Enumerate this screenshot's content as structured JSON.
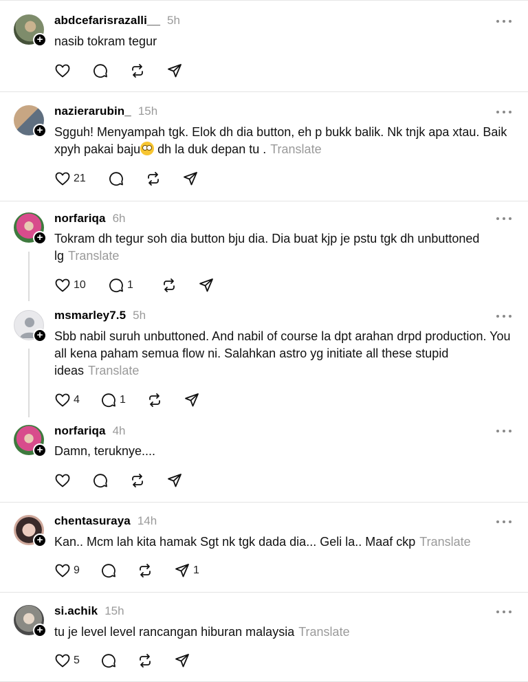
{
  "posts": [
    {
      "username": "abdcefarisrazalli__",
      "time": "5h",
      "text": "nasib tokram tegur",
      "translate": "",
      "likes": "",
      "replies": "",
      "shares": "",
      "avatar_colors": [
        "#8a9a7a",
        "#4a5a3a"
      ]
    },
    {
      "username": "nazierarubin_",
      "time": "15h",
      "text": "Sgguh! Menyampah tgk. Elok dh dia button, eh p bukk balik. Nk tnjk apa xtau. Baik xpyh pakai baju",
      "text_after_emoji": " dh la duk depan tu .",
      "emoji": "flushed-face",
      "translate": "Translate",
      "likes": "21",
      "replies": "",
      "shares": "",
      "avatar_colors": [
        "#b09070",
        "#6a7a8a"
      ]
    },
    {
      "username": "norfariqa",
      "time": "6h",
      "text": "Tokram dh tegur soh dia button bju dia. Dia buat kjp je pstu tgk dh unbuttoned lg",
      "translate": "Translate",
      "likes": "10",
      "replies": "1",
      "shares": "",
      "avatar_colors": [
        "#d84c8c",
        "#3e7a3e"
      ]
    },
    {
      "username": "msmarley7.5",
      "time": "5h",
      "text": "Sbb nabil suruh unbuttoned. And nabil of course la dpt arahan drpd production. You all kena paham semua flow ni. Salahkan astro yg initiate all these stupid ideas",
      "translate": "Translate",
      "likes": "4",
      "replies": "1",
      "shares": "",
      "avatar_colors": [
        "#e6e6e9",
        "#9ea3ab"
      ]
    },
    {
      "username": "norfariqa",
      "time": "4h",
      "text": "Damn, teruknye....",
      "translate": "",
      "likes": "",
      "replies": "",
      "shares": "",
      "avatar_colors": [
        "#d84c8c",
        "#3e7a3e"
      ]
    },
    {
      "username": "chentasuraya",
      "time": "14h",
      "text": "Kan.. Mcm lah kita hamak Sgt nk tgk dada dia... Geli la.. Maaf ckp",
      "translate": "Translate",
      "likes": "9",
      "replies": "",
      "shares": "1",
      "avatar_colors": [
        "#e8c8c0",
        "#3a2a2a"
      ]
    },
    {
      "username": "si.achik",
      "time": "15h",
      "text": "tu je level level rancangan hiburan malaysia",
      "translate": "Translate",
      "likes": "5",
      "replies": "",
      "shares": "",
      "avatar_colors": [
        "#c8c0b0",
        "#4a4a4a"
      ]
    }
  ],
  "icons": {
    "like": "heart-icon",
    "reply": "comment-icon",
    "repost": "repost-icon",
    "share": "send-icon",
    "more": "more-icon",
    "follow": "plus-icon"
  }
}
